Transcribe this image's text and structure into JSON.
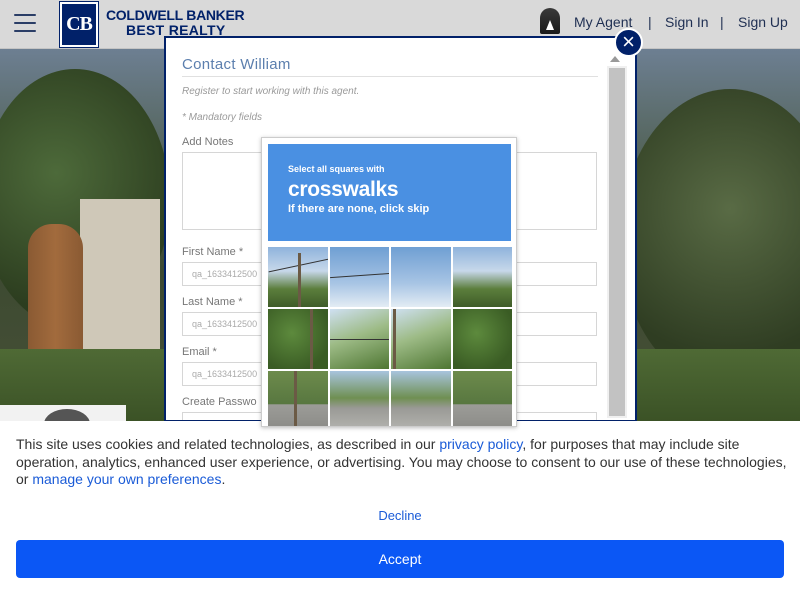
{
  "header": {
    "brand_line1": "COLDWELL BANKER",
    "brand_line2": "BEST REALTY",
    "logo_mark": "CB",
    "my_agent": "My Agent",
    "separator": "|",
    "sign_in": "Sign In",
    "sign_up": "Sign Up"
  },
  "modal": {
    "title": "Contact William",
    "subtitle": "Register to start working with this agent.",
    "mandatory": "* Mandatory fields",
    "close_glyph": "×",
    "fields": {
      "notes_label": "Add Notes",
      "first_name_label": "First Name *",
      "first_name_value": "qa_1633412500",
      "last_name_label": "Last Name *",
      "last_name_value": "qa_1633412500",
      "email_label": "Email *",
      "email_value": "qa_1633412500",
      "password_label": "Create Passwo"
    }
  },
  "captcha": {
    "instruction_small": "Select all squares with",
    "instruction_big": "crosswalks",
    "instruction_note": "If there are none, click skip"
  },
  "cookie": {
    "text_before": "This site uses cookies and related technologies, as described in our ",
    "privacy_link": "privacy policy",
    "text_middle": ", for purposes that may include site operation, analytics, enhanced user experience, or advertising. You may choose to consent to our use of these technologies, or ",
    "prefs_link": "manage your own preferences",
    "text_after": ".",
    "decline": "Decline",
    "accept": "Accept"
  },
  "colors": {
    "brand_navy": "#012169",
    "captcha_blue": "#4a90e2",
    "accept_blue": "#0b57f5",
    "link_blue": "#1a5bd7"
  },
  "icons": [
    "hamburger-menu-icon",
    "close-icon",
    "agent-photo"
  ]
}
